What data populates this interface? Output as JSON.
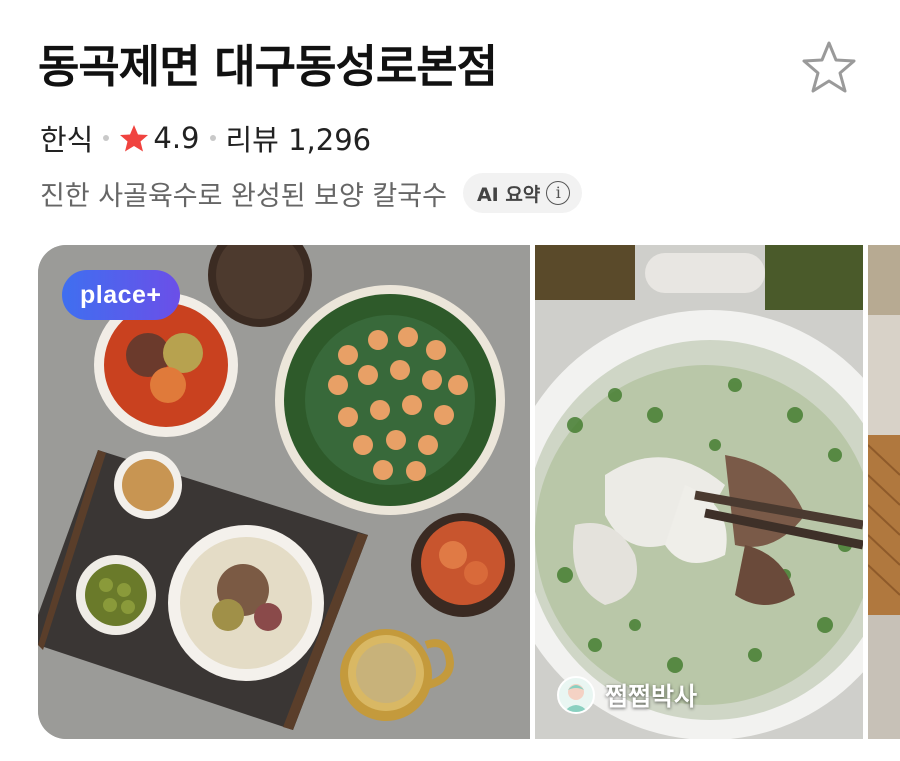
{
  "place": {
    "name": "동곡제면 대구동성로본점",
    "category": "한식",
    "rating": "4.9",
    "review_label": "리뷰 1,296",
    "description": "진한 사골육수로 완성된 보양 칼국수"
  },
  "ai_summary": {
    "label": "AI 요약",
    "info_glyph": "i"
  },
  "gallery": {
    "badge": "place+",
    "author": "쩝쩝박사"
  },
  "colors": {
    "rating_star": "#f0433f",
    "badge_start": "#3f6ff0",
    "badge_end": "#6b4fe8"
  },
  "icons": [
    "star-outline-icon",
    "rating-star-icon",
    "info-icon"
  ]
}
